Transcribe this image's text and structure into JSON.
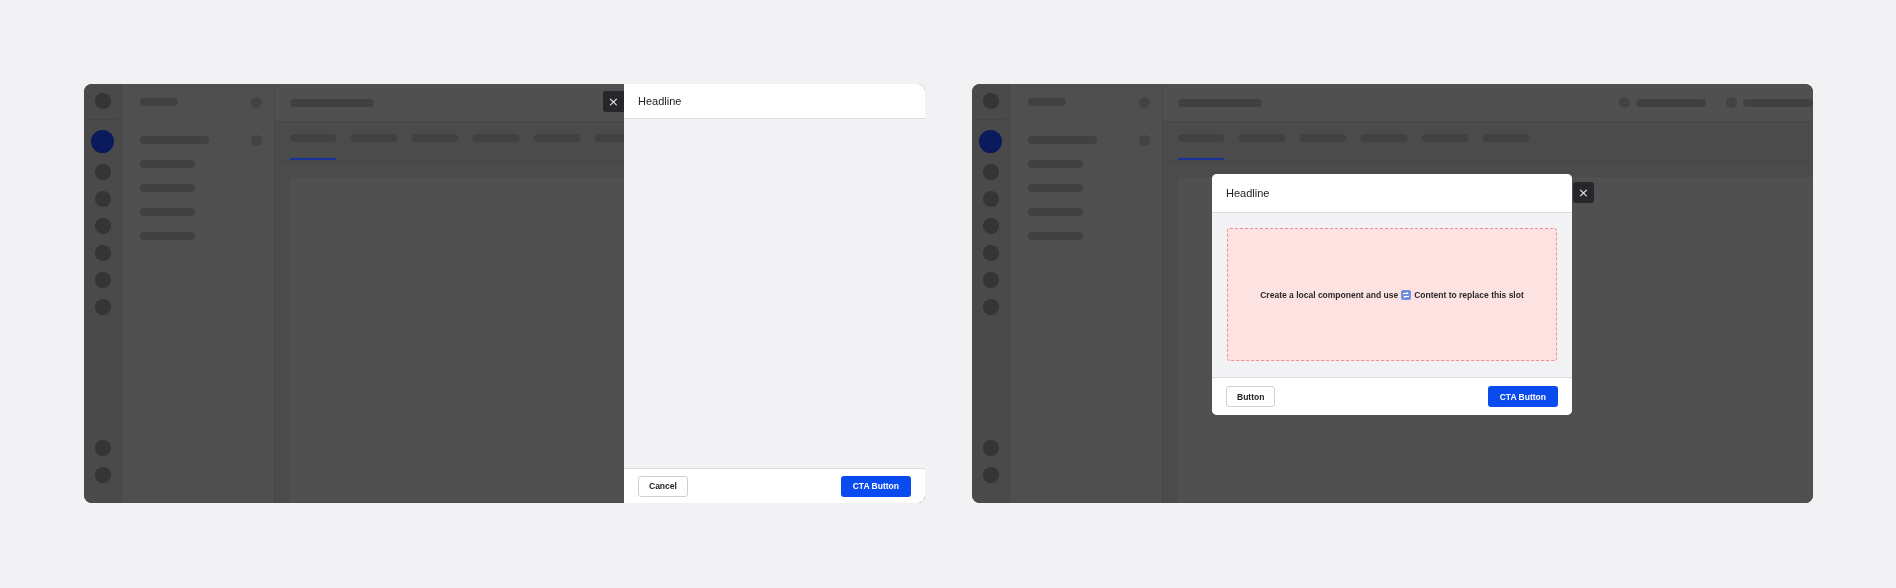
{
  "frames": [
    {
      "kind": "drawer",
      "backdrop": {
        "rail": [
          {
            "selected": true
          },
          {
            "selected": false
          },
          {
            "selected": false
          },
          {
            "selected": false
          },
          {
            "selected": false
          },
          {
            "selected": false
          },
          {
            "selected": false
          }
        ],
        "tabs": [
          {
            "selected": true
          },
          {
            "selected": false
          },
          {
            "selected": false
          },
          {
            "selected": false
          },
          {
            "selected": false
          },
          {
            "selected": false
          }
        ]
      },
      "overlay": {
        "title": "Headline",
        "close": "×",
        "buttons": [
          {
            "label": "Cancel",
            "kind": "secondary"
          },
          {
            "label": "CTA Button",
            "kind": "primary"
          }
        ]
      }
    },
    {
      "kind": "modal",
      "backdrop": {
        "rail": [
          {
            "selected": true
          },
          {
            "selected": false
          },
          {
            "selected": false
          },
          {
            "selected": false
          },
          {
            "selected": false
          },
          {
            "selected": false
          },
          {
            "selected": false
          }
        ],
        "tabs": [
          {
            "selected": true
          },
          {
            "selected": false
          },
          {
            "selected": false
          },
          {
            "selected": false
          },
          {
            "selected": false
          },
          {
            "selected": false
          }
        ]
      },
      "overlay": {
        "title": "Headline",
        "close": "×",
        "slot": {
          "before": "Create a local component and use",
          "after": "Content to replace this slot"
        },
        "buttons": [
          {
            "label": "Button",
            "kind": "secondary"
          },
          {
            "label": "CTA Button",
            "kind": "primary"
          }
        ]
      }
    }
  ]
}
